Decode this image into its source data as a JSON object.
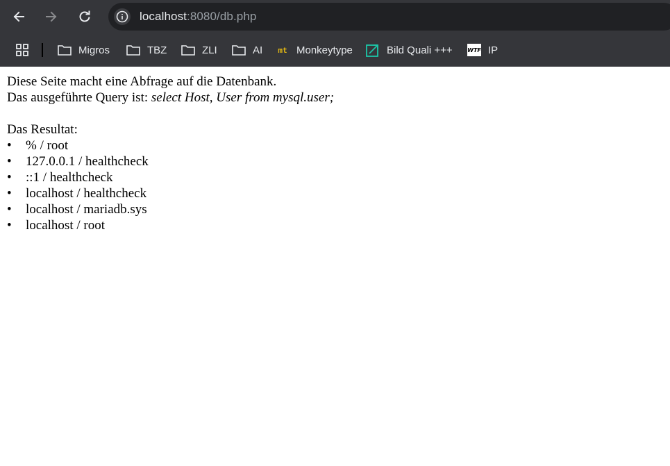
{
  "browser": {
    "url_host": "localhost",
    "url_rest": ":8080/db.php",
    "bookmarks": [
      {
        "label": "Migros",
        "icon": "folder-icon"
      },
      {
        "label": "TBZ",
        "icon": "folder-icon"
      },
      {
        "label": "ZLI",
        "icon": "folder-icon"
      },
      {
        "label": "AI",
        "icon": "folder-icon"
      },
      {
        "label": "Monkeytype",
        "icon": "monkeytype-icon",
        "icon_text": "mt"
      },
      {
        "label": "Bild Quali +++",
        "icon": "bild-quali-icon"
      },
      {
        "label": "IP",
        "icon": "wtf-icon",
        "icon_text": "WTF"
      }
    ]
  },
  "page": {
    "intro": "Diese Seite macht eine Abfrage auf die Datenbank.",
    "query_prefix": "Das ausgeführte Query ist: ",
    "query": "select Host, User from mysql.user;",
    "result_heading": "Das Resultat:",
    "results": [
      "% / root",
      "127.0.0.1 / healthcheck",
      "::1 / healthcheck",
      "localhost / healthcheck",
      "localhost / mariadb.sys",
      "localhost / root"
    ]
  },
  "colors": {
    "chrome_bg": "#35363a",
    "omnibox_bg": "#202124",
    "monkeytype_accent": "#e2b714",
    "bild_quali_accent": "#1cc6a8"
  }
}
